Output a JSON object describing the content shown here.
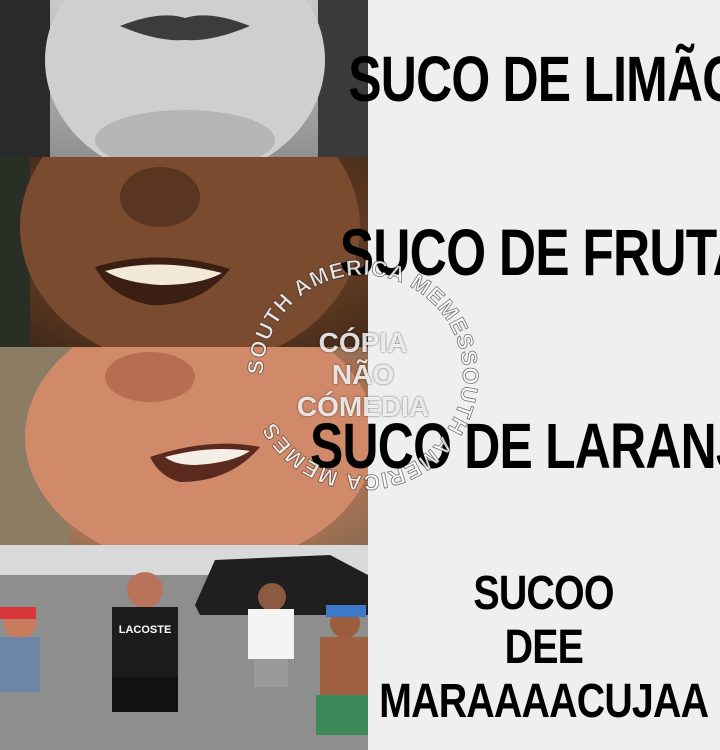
{
  "panels": [
    {
      "caption": "SUCO DE LIMÃO"
    },
    {
      "caption": "SUCO DE FRUTA"
    },
    {
      "caption": "SUCO DE LARANJA"
    },
    {
      "caption_lines": [
        "SUCOO",
        "DEE",
        "MARAAAACUJAA"
      ]
    }
  ],
  "watermark": {
    "ring_text": "SOUTH AMERICA MEMESSOUTH AMERICA MEMES",
    "center_lines": [
      "CÓPIA",
      "NÃO",
      "CÓMEDIA"
    ]
  },
  "photo4": {
    "shirt_text": "LACOSTE"
  }
}
